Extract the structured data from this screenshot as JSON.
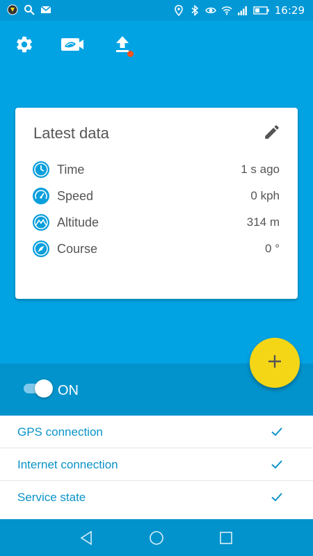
{
  "status_bar": {
    "time": "16:29",
    "left_icons": [
      "app-notification-icon",
      "search-icon",
      "mail-icon"
    ],
    "right_icons": [
      "location-icon",
      "bluetooth-icon",
      "eye-icon",
      "wifi-icon",
      "signal-icon",
      "battery-icon"
    ]
  },
  "toolbar": {
    "buttons": [
      "gear-icon",
      "camera-icon",
      "upload-icon"
    ],
    "upload_badge_color": "#F4511E"
  },
  "card": {
    "title": "Latest data",
    "rows": [
      {
        "icon": "clock-icon",
        "label": "Time",
        "value": "1 s ago"
      },
      {
        "icon": "speedometer-icon",
        "label": "Speed",
        "value": "0 kph"
      },
      {
        "icon": "mountain-icon",
        "label": "Altitude",
        "value": "314 m"
      },
      {
        "icon": "compass-icon",
        "label": "Course",
        "value": "0 °"
      }
    ]
  },
  "fab": {
    "icon": "plus-icon",
    "color": "#F5D617"
  },
  "toggle": {
    "label": "ON",
    "state": true
  },
  "status_list": [
    {
      "label": "GPS connection",
      "ok": true
    },
    {
      "label": "Internet connection",
      "ok": true
    },
    {
      "label": "Service state",
      "ok": true
    }
  ],
  "nav_bar": [
    "back-icon",
    "home-icon",
    "recents-icon"
  ],
  "colors": {
    "primary": "#02A3E3",
    "dark": "#0293CC",
    "accent": "#F5D617",
    "text_blue": "#0A93C8"
  }
}
